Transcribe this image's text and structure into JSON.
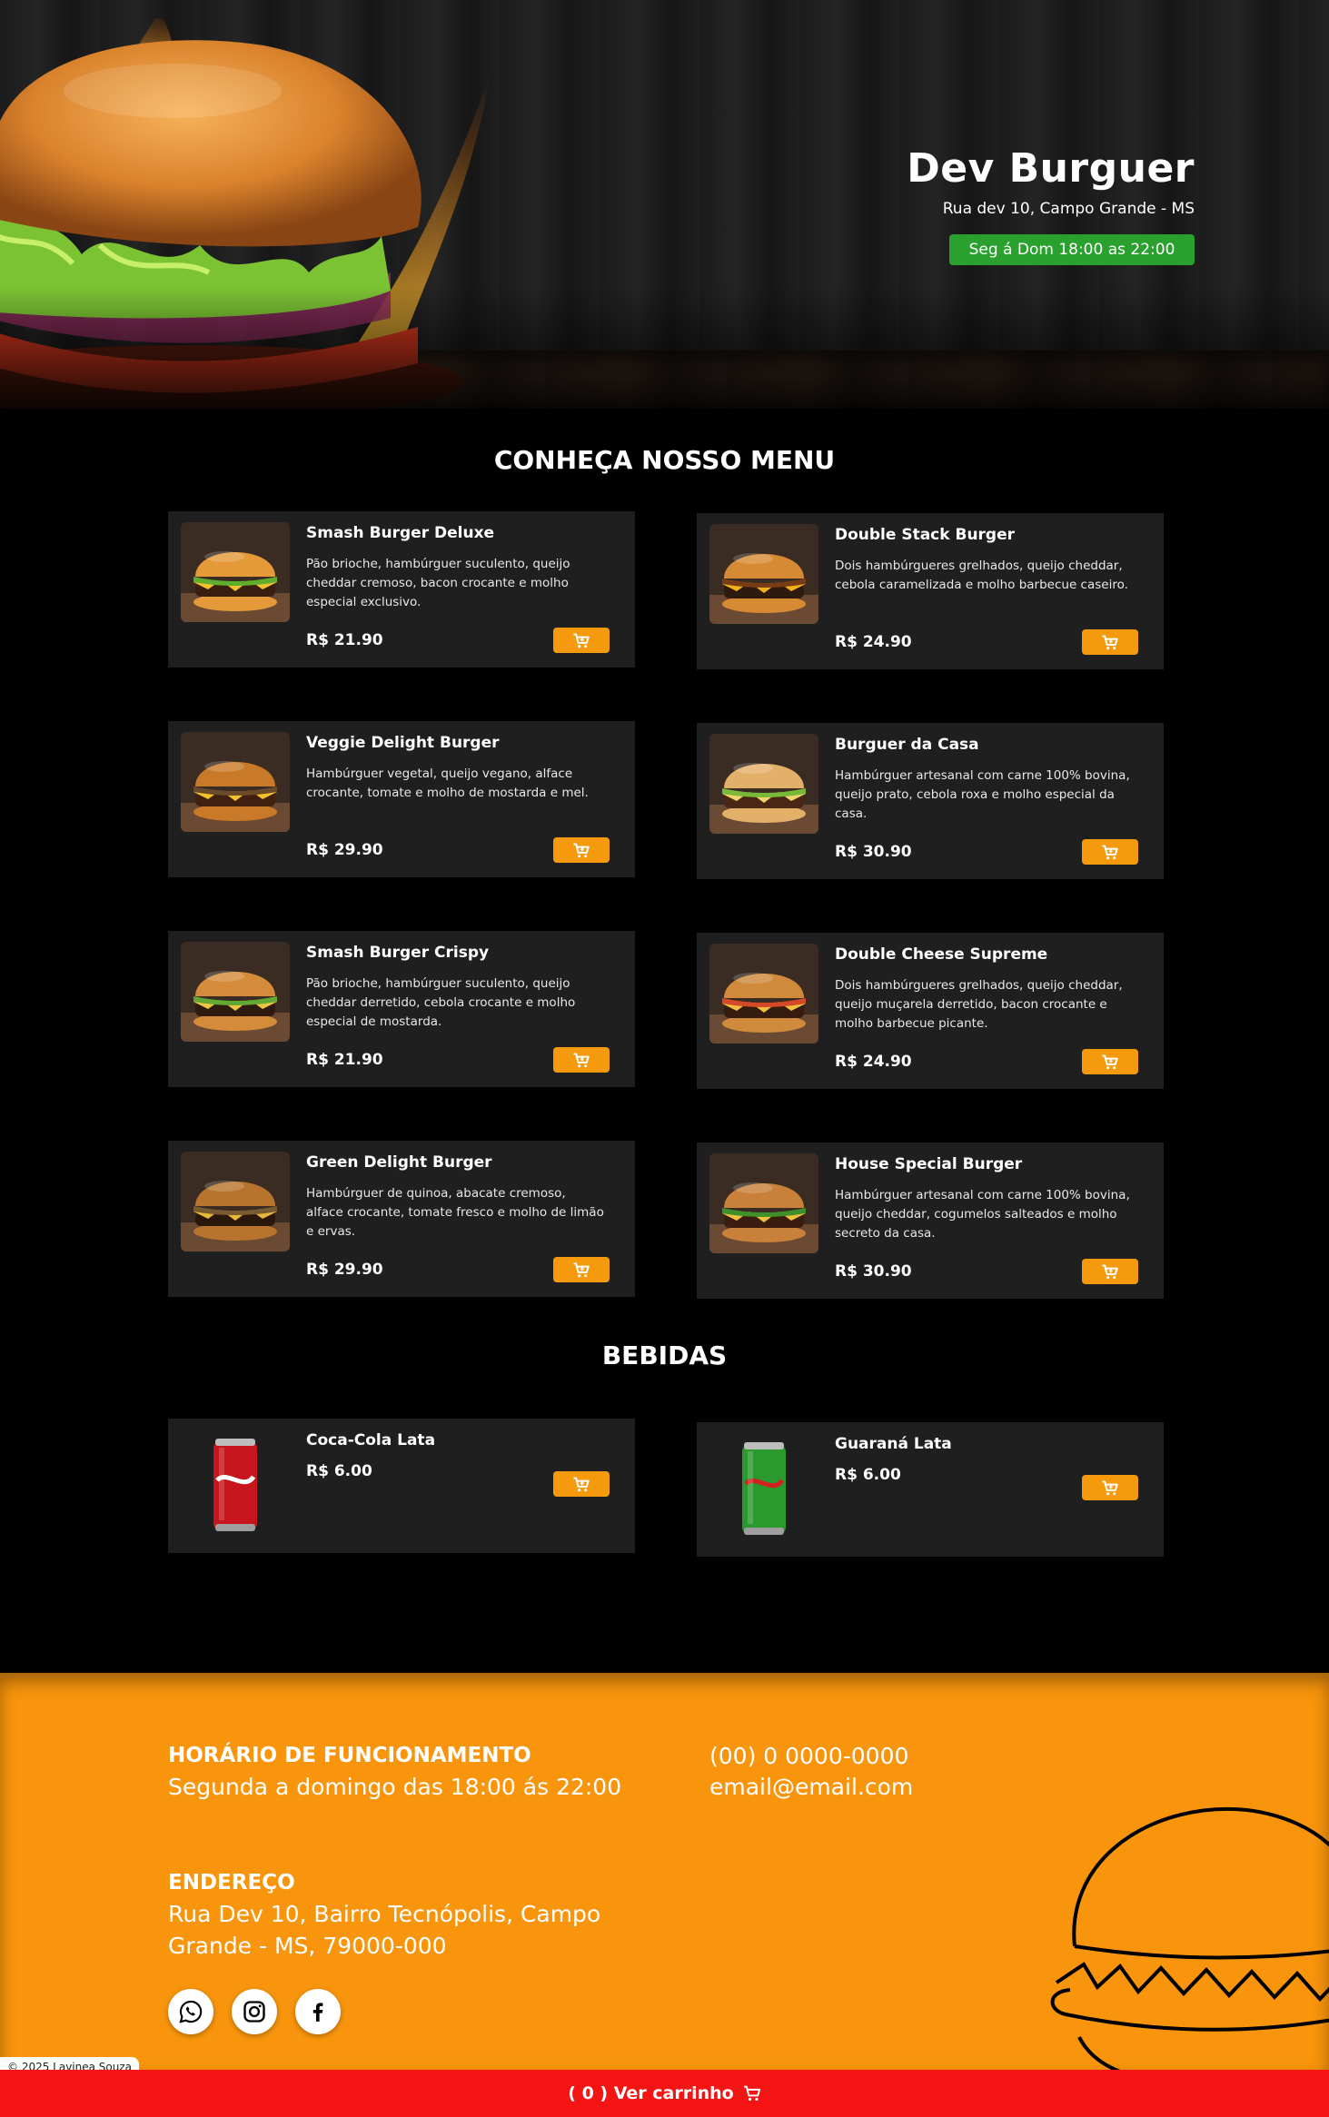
{
  "hero": {
    "title": "Dev Burguer",
    "address": "Rua dev 10, Campo Grande - MS",
    "hours": "Seg á Dom 18:00 as 22:00",
    "hours_color": "#2aa12e"
  },
  "menu": {
    "title": "CONHEÇA NOSSO MENU",
    "items": [
      {
        "name": "Smash Burger Deluxe",
        "desc": "Pão brioche, hambúrguer suculento, queijo cheddar cremoso, bacon crocante e molho especial exclusivo.",
        "price": "R$ 21.90"
      },
      {
        "name": "Double Stack Burger",
        "desc": "Dois hambúrgueres grelhados, queijo cheddar, cebola caramelizada e molho barbecue caseiro.",
        "price": "R$ 24.90"
      },
      {
        "name": "Veggie Delight Burger",
        "desc": "Hambúrguer vegetal, queijo vegano, alface crocante, tomate e molho de mostarda e mel.",
        "price": "R$ 29.90"
      },
      {
        "name": "Burguer da Casa",
        "desc": "Hambúrguer artesanal com carne 100% bovina, queijo prato, cebola roxa e molho especial da casa.",
        "price": "R$ 30.90"
      },
      {
        "name": "Smash Burger Crispy",
        "desc": "Pão brioche, hambúrguer suculento, queijo cheddar derretido, cebola crocante e molho especial de mostarda.",
        "price": "R$ 21.90"
      },
      {
        "name": "Double Cheese Supreme",
        "desc": "Dois hambúrgueres grelhados, queijo cheddar, queijo muçarela derretido, bacon crocante e molho barbecue picante.",
        "price": "R$ 24.90"
      },
      {
        "name": "Green Delight Burger",
        "desc": "Hambúrguer de quinoa, abacate cremoso, alface crocante, tomate fresco e molho de limão e ervas.",
        "price": "R$ 29.90"
      },
      {
        "name": "House Special Burger",
        "desc": "Hambúrguer artesanal com carne 100% bovina, queijo cheddar, cogumelos salteados e molho secreto da casa.",
        "price": "R$ 30.90"
      }
    ]
  },
  "drinks": {
    "title": "BEBIDAS",
    "items": [
      {
        "name": "Coca-Cola Lata",
        "price": "R$ 6.00"
      },
      {
        "name": "Guaraná Lata",
        "price": "R$ 6.00"
      }
    ]
  },
  "footer": {
    "hours_title": "HORÁRIO DE FUNCIONAMENTO",
    "hours_text": "Segunda a domingo das 18:00 ás 22:00",
    "phone": "(00) 0 0000-0000",
    "email": "email@email.com",
    "address_title": "ENDEREÇO",
    "address_line1": "Rua Dev 10, Bairro Tecnópolis, Campo",
    "address_line2": "Grande - MS, 79000-000",
    "social": [
      "whatsapp-icon",
      "instagram-icon",
      "facebook-icon"
    ],
    "background": "#f8950c"
  },
  "copyright": "© 2025 Lavinea Souza",
  "cart": {
    "label": "( 0 ) Ver carrinho",
    "background": "#f41414"
  },
  "accent": "#f49a0c"
}
